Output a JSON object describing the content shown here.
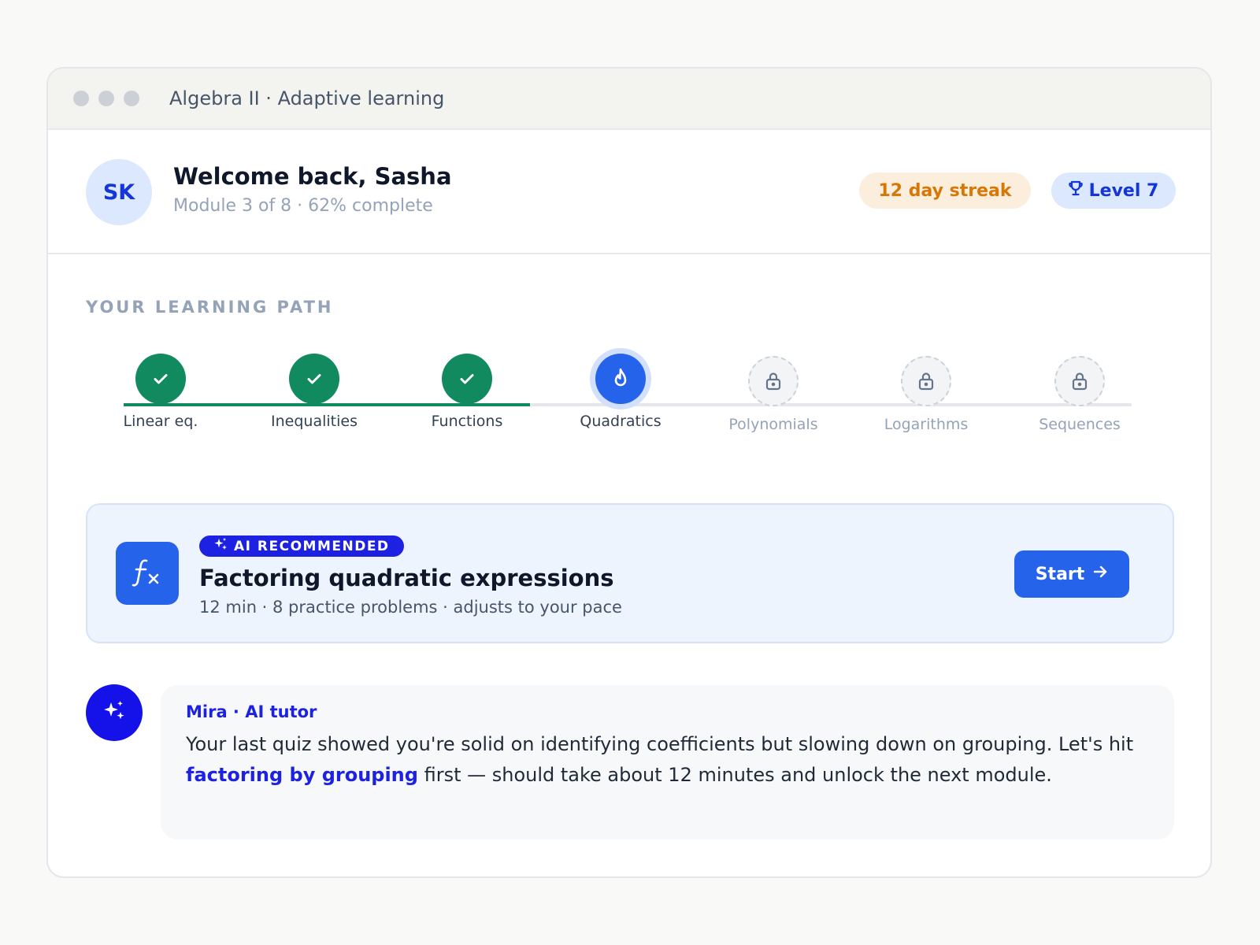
{
  "window": {
    "title": "Algebra II · Adaptive learning"
  },
  "header": {
    "avatar_initials": "SK",
    "welcome": "Welcome back, Sasha",
    "progress": "Module 3 of 8 · 62% complete",
    "streak": "12 day streak",
    "level": "Level 7"
  },
  "path": {
    "label": "YOUR LEARNING PATH",
    "steps": [
      {
        "label": "Linear eq.",
        "status": "done"
      },
      {
        "label": "Inequalities",
        "status": "done"
      },
      {
        "label": "Functions",
        "status": "done"
      },
      {
        "label": "Quadratics",
        "status": "current"
      },
      {
        "label": "Polynomials",
        "status": "locked"
      },
      {
        "label": "Logarithms",
        "status": "locked"
      },
      {
        "label": "Sequences",
        "status": "locked"
      }
    ]
  },
  "recommendation": {
    "badge": "AI RECOMMENDED",
    "title": "Factoring quadratic expressions",
    "meta": "12 min · 8 practice problems · adjusts to your pace",
    "start_label": "Start"
  },
  "tutor": {
    "name": "Mira · AI tutor",
    "message_before": "Your last quiz showed you're solid on identifying coefficients but slowing down on grouping. Let's hit ",
    "message_highlight": "factoring by grouping",
    "message_after": " first — should take about 12 minutes and unlock the next module."
  },
  "colors": {
    "done": "#108a5e",
    "current": "#2563eb",
    "locked": "#cbd2da",
    "accent": "#1d22e2",
    "streak": "#d97706"
  }
}
